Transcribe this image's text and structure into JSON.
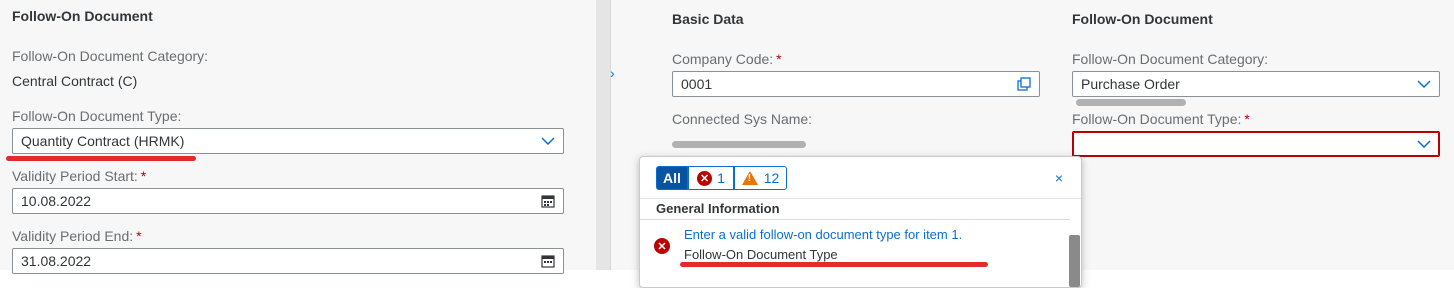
{
  "left": {
    "section_title": "Follow-On Document",
    "category_label": "Follow-On Document Category:",
    "category_value": "Central Contract (C)",
    "type_label": "Follow-On Document Type:",
    "type_value": "Quantity Contract (HRMK)",
    "validity_start_label": "Validity Period Start:",
    "validity_start_value": "10.08.2022",
    "validity_end_label": "Validity Period End:",
    "validity_end_value": "31.08.2022",
    "required_marker": "*"
  },
  "basic_data": {
    "section_title": "Basic Data",
    "company_code_label": "Company Code:",
    "company_code_value": "0001",
    "connected_sys_label": "Connected Sys Name:",
    "required_marker": "*"
  },
  "right_follow_on": {
    "section_title": "Follow-On Document",
    "category_label": "Follow-On Document Category:",
    "category_value": "Purchase Order",
    "type_label": "Follow-On Document Type:",
    "type_value": "",
    "required_marker": "*"
  },
  "message_popover": {
    "tab_all": "All",
    "error_count": "1",
    "warning_count": "12",
    "close_symbol": "×",
    "group_title": "General Information",
    "message_text": "Enter a valid follow-on document type for item 1.",
    "message_subtitle": "Follow-On Document Type"
  },
  "colors": {
    "accent": "#0a6ed1",
    "error": "#bb0000",
    "warning": "#e9730c",
    "annotation_red": "#e32b2b"
  }
}
